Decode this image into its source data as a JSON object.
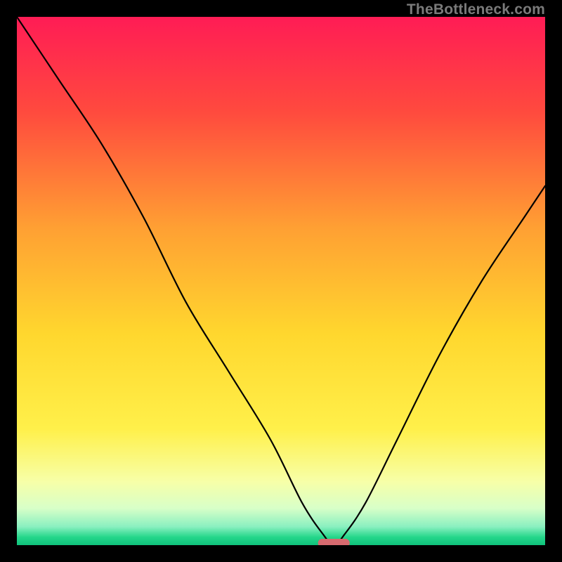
{
  "watermark": "TheBottleneck.com",
  "chart_data": {
    "type": "line",
    "title": "",
    "xlabel": "",
    "ylabel": "",
    "xlim": [
      0,
      100
    ],
    "ylim": [
      0,
      100
    ],
    "grid": false,
    "legend": false,
    "series": [
      {
        "name": "bottleneck-curve",
        "x": [
          0,
          8,
          16,
          24,
          32,
          40,
          48,
          54,
          58,
          60,
          62,
          66,
          72,
          80,
          88,
          96,
          100
        ],
        "values": [
          100,
          88,
          76,
          62,
          46,
          33,
          20,
          8,
          2,
          0,
          2,
          8,
          20,
          36,
          50,
          62,
          68
        ]
      }
    ],
    "marker": {
      "name": "optimal-range",
      "x_start": 57,
      "x_end": 63,
      "y": 0.4,
      "color": "#d76a6f"
    },
    "gradient_stops": [
      {
        "offset": 0,
        "color": "#ff1c55"
      },
      {
        "offset": 0.18,
        "color": "#ff4a3e"
      },
      {
        "offset": 0.4,
        "color": "#ffa033"
      },
      {
        "offset": 0.6,
        "color": "#ffd72e"
      },
      {
        "offset": 0.78,
        "color": "#fff04a"
      },
      {
        "offset": 0.88,
        "color": "#f7ffa8"
      },
      {
        "offset": 0.93,
        "color": "#d8ffc8"
      },
      {
        "offset": 0.965,
        "color": "#8af0c0"
      },
      {
        "offset": 0.985,
        "color": "#24d68a"
      },
      {
        "offset": 1.0,
        "color": "#0fc27b"
      }
    ]
  }
}
